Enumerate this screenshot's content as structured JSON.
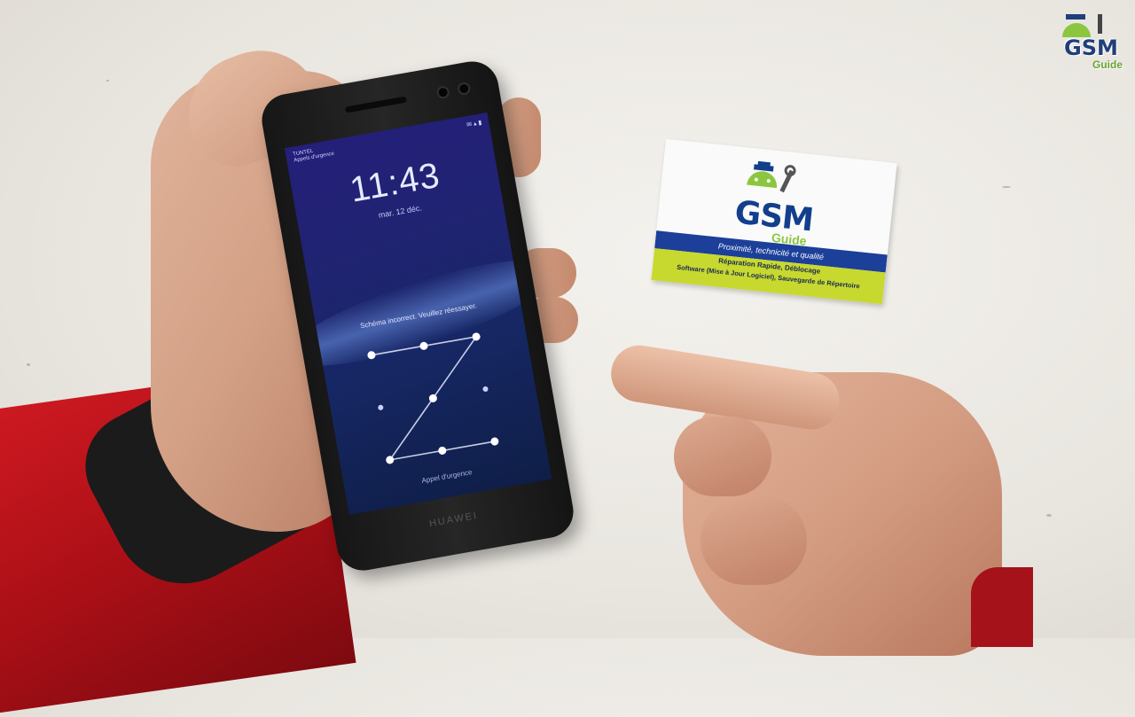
{
  "phone": {
    "carrier_line1": "TUNTEL",
    "carrier_line2": "Appels d'urgence",
    "status_icons": "✉ ▴ ▮",
    "clock": "11:43",
    "date": "mar. 12 déc.",
    "message": "Schéma incorrect. Veuillez réessayer.",
    "emergency": "Appel d'urgence",
    "brand": "HUAWEI",
    "pattern_path": [
      1,
      2,
      3,
      5,
      7,
      8,
      9
    ]
  },
  "card": {
    "title": "GSM",
    "subtitle": "Guide",
    "tagline": "Proximité, technicité et qualité",
    "line1": "Réparation Rapide, Déblocage",
    "line2": "Software (Mise à Jour Logiciel), Sauvegarde de Répertoire"
  },
  "watermark": {
    "title": "GSM",
    "subtitle": "Guide"
  },
  "colors": {
    "brand_blue": "#113f8c",
    "brand_green": "#8cc63f",
    "sleeve_red": "#c8141c",
    "screen_blue": "#1f2470"
  }
}
